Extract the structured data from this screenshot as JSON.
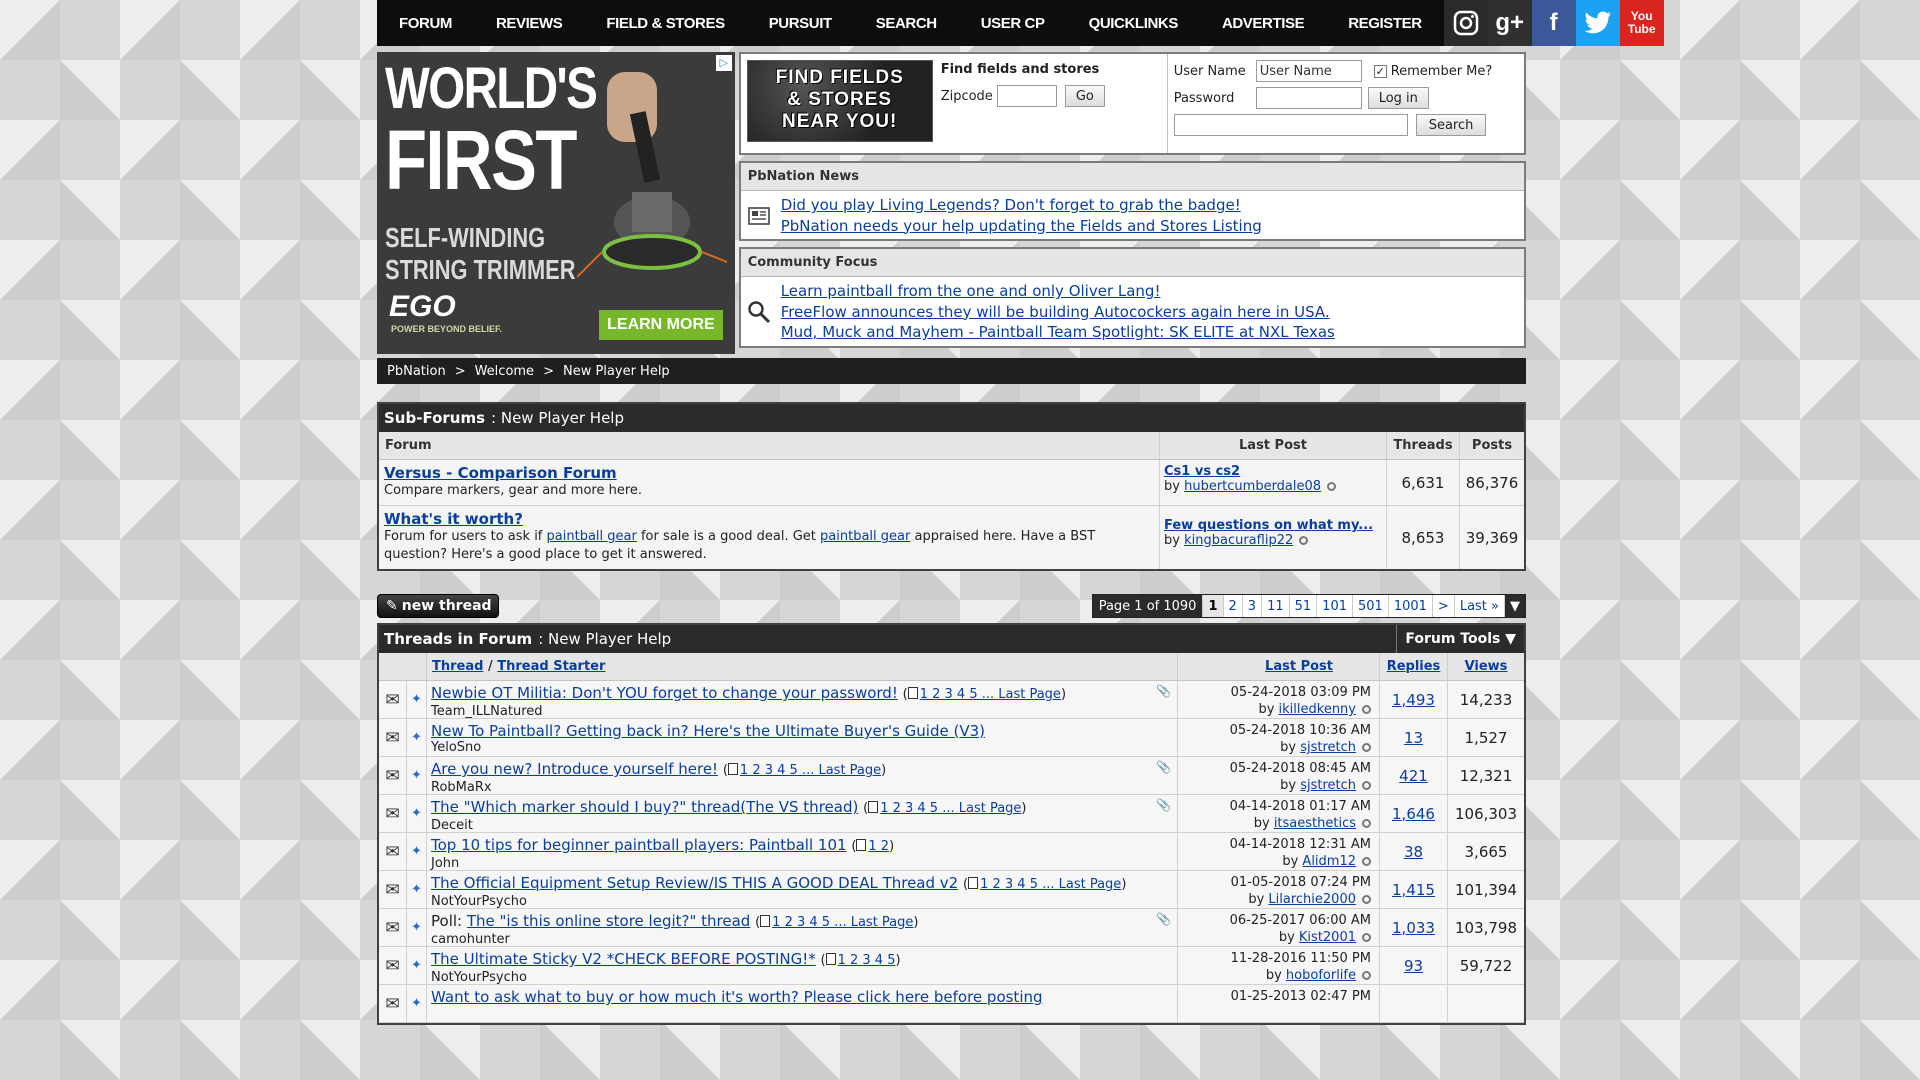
{
  "nav": {
    "items": [
      "FORUM",
      "REVIEWS",
      "FIELD & STORES",
      "PURSUIT",
      "SEARCH",
      "USER CP",
      "QUICKLINKS",
      "ADVERTISE",
      "REGISTER"
    ],
    "social": {
      "gplus": "g+",
      "facebook": "f",
      "twitter": "t",
      "youtube_1": "You",
      "youtube_2": "Tube"
    }
  },
  "ad": {
    "line1": "WORLD'S",
    "line2": "FIRST",
    "line3": "SELF-WINDING",
    "line4": "STRING TRIMMER",
    "brand": "EGO",
    "brand_sub": "POWER BEYOND BELIEF.",
    "cta": "LEARN MORE",
    "adchoice": "▷"
  },
  "finder": {
    "logo_1": "FIND FIELDS",
    "logo_2": "& STORES",
    "logo_3": "NEAR YOU!",
    "title": "Find fields and stores",
    "zip_label": "Zipcode",
    "zip_value": "",
    "go": "Go"
  },
  "login": {
    "user_label": "User Name",
    "user_value": "User Name",
    "remember": "Remember Me?",
    "pass_label": "Password",
    "login_btn": "Log in",
    "search_value": "",
    "search_btn": "Search"
  },
  "news": {
    "title": "PbNation News",
    "links": [
      "Did you play Living Legends? Don't forget to grab the badge!",
      "PbNation needs your help updating the Fields and Stores Listing"
    ]
  },
  "focus": {
    "title": "Community Focus",
    "links": [
      "Learn paintball from the one and only Oliver Lang!",
      "FreeFlow announces they will be building Autocockers again here in USA.",
      "Mud, Muck and Mayhem - Paintball Team Spotlight: SK ELITE at NXL Texas"
    ]
  },
  "breadcrumb": [
    "PbNation",
    ">",
    "Welcome",
    ">",
    "New Player Help"
  ],
  "subforums": {
    "title_bold": "Sub-Forums",
    "title_rest": ": New Player Help",
    "headers": {
      "forum": "Forum",
      "last_post": "Last Post",
      "threads": "Threads",
      "posts": "Posts"
    },
    "rows": [
      {
        "name": "Versus - Comparison Forum",
        "desc": "Compare markers, gear and more here.",
        "last_title": "Cs1 vs cs2",
        "by": "by",
        "last_user": "hubertcumberdale08",
        "threads": "6,631",
        "posts": "86,376"
      },
      {
        "name": "What's it worth?",
        "desc_1": "Forum for users to ask if ",
        "desc_link_1": "paintball gear",
        "desc_2": " for sale is a good deal. Get ",
        "desc_link_2": "paintball gear",
        "desc_3": " appraised here. Have a BST question? Here's a good place to get it answered.",
        "last_title": "Few questions on what my...",
        "by": "by",
        "last_user": "kingbacuraflip22",
        "threads": "8,653",
        "posts": "39,369"
      }
    ]
  },
  "toolbar": {
    "new_thread": "new thread",
    "pager_info": "Page 1 of 1090",
    "pages": [
      "1",
      "2",
      "3",
      "11",
      "51",
      "101",
      "501",
      "1001",
      ">",
      "Last »"
    ],
    "dropdown": "▼"
  },
  "threads": {
    "title_bold": "Threads in Forum",
    "title_rest": ": New Player Help",
    "tools": "Forum Tools ▼",
    "headers": {
      "thread": "Thread",
      "slash": " / ",
      "starter": "Thread Starter",
      "last_post": "Last Post",
      "replies": "Replies",
      "views": "Views"
    },
    "rows": [
      {
        "prefix": "",
        "title": "Newbie OT Militia: Don't YOU forget to change your password!",
        "pages": "1 2 3 4 5 ... ",
        "lastpage": "Last Page",
        "starter": "Team_ILLNatured",
        "date": "05-24-2018 03:09 PM",
        "by": "by",
        "user": "ikilledkenny",
        "replies": "1,493",
        "views": "14,233",
        "clip": true
      },
      {
        "prefix": "",
        "title": "New To Paintball? Getting back in? Here's the Ultimate Buyer's Guide (V3)",
        "pages": "",
        "lastpage": "",
        "starter": "YeloSno",
        "date": "05-24-2018 10:36 AM",
        "by": "by",
        "user": "sjstretch",
        "replies": "13",
        "views": "1,527",
        "clip": false
      },
      {
        "prefix": "",
        "title": "Are you new? Introduce yourself here!",
        "pages": "1 2 3 4 5 ... ",
        "lastpage": "Last Page",
        "starter": "RobMaRx",
        "date": "05-24-2018 08:45 AM",
        "by": "by",
        "user": "sjstretch",
        "replies": "421",
        "views": "12,321",
        "clip": true
      },
      {
        "prefix": "",
        "title": "The \"Which marker should I buy?\" thread(The VS thread)",
        "pages": "1 2 3 4 5 ... ",
        "lastpage": "Last Page",
        "starter": "Deceit",
        "date": "04-14-2018 01:17 AM",
        "by": "by",
        "user": "itsaesthetics",
        "replies": "1,646",
        "views": "106,303",
        "clip": true
      },
      {
        "prefix": "",
        "title": "Top 10 tips for beginner paintball players: Paintball 101",
        "pages": "1 2",
        "lastpage": "",
        "starter": "John",
        "date": "04-14-2018 12:31 AM",
        "by": "by",
        "user": "Alidm12",
        "replies": "38",
        "views": "3,665",
        "clip": false
      },
      {
        "prefix": "",
        "title": "The Official Equipment Setup Review/IS THIS A GOOD DEAL Thread v2",
        "pages": "1 2 3 4 5 ... ",
        "lastpage": "Last Page",
        "starter": "NotYourPsycho",
        "date": "01-05-2018 07:24 PM",
        "by": "by",
        "user": "Lilarchie2000",
        "replies": "1,415",
        "views": "101,394",
        "clip": false
      },
      {
        "prefix": "Poll: ",
        "title": "The \"is this online store legit?\" thread",
        "pages": "1 2 3 4 5 ... ",
        "lastpage": "Last Page",
        "starter": "camohunter",
        "date": "06-25-2017 06:00 AM",
        "by": "by",
        "user": "Kist2001",
        "replies": "1,033",
        "views": "103,798",
        "clip": true
      },
      {
        "prefix": "",
        "title": "The Ultimate Sticky V2 *CHECK BEFORE POSTING!*",
        "pages": "1 2 3 4 5",
        "lastpage": "",
        "starter": "NotYourPsycho",
        "date": "11-28-2016 11:50 PM",
        "by": "by",
        "user": "hoboforlife",
        "replies": "93",
        "views": "59,722",
        "clip": false
      },
      {
        "prefix": "",
        "title": "Want to ask what to buy or how much it's worth? Please click here before posting",
        "pages": "",
        "lastpage": "",
        "starter": "",
        "date": "01-25-2013 02:47 PM",
        "by": "",
        "user": "",
        "replies": "",
        "views": "",
        "clip": false
      }
    ]
  }
}
